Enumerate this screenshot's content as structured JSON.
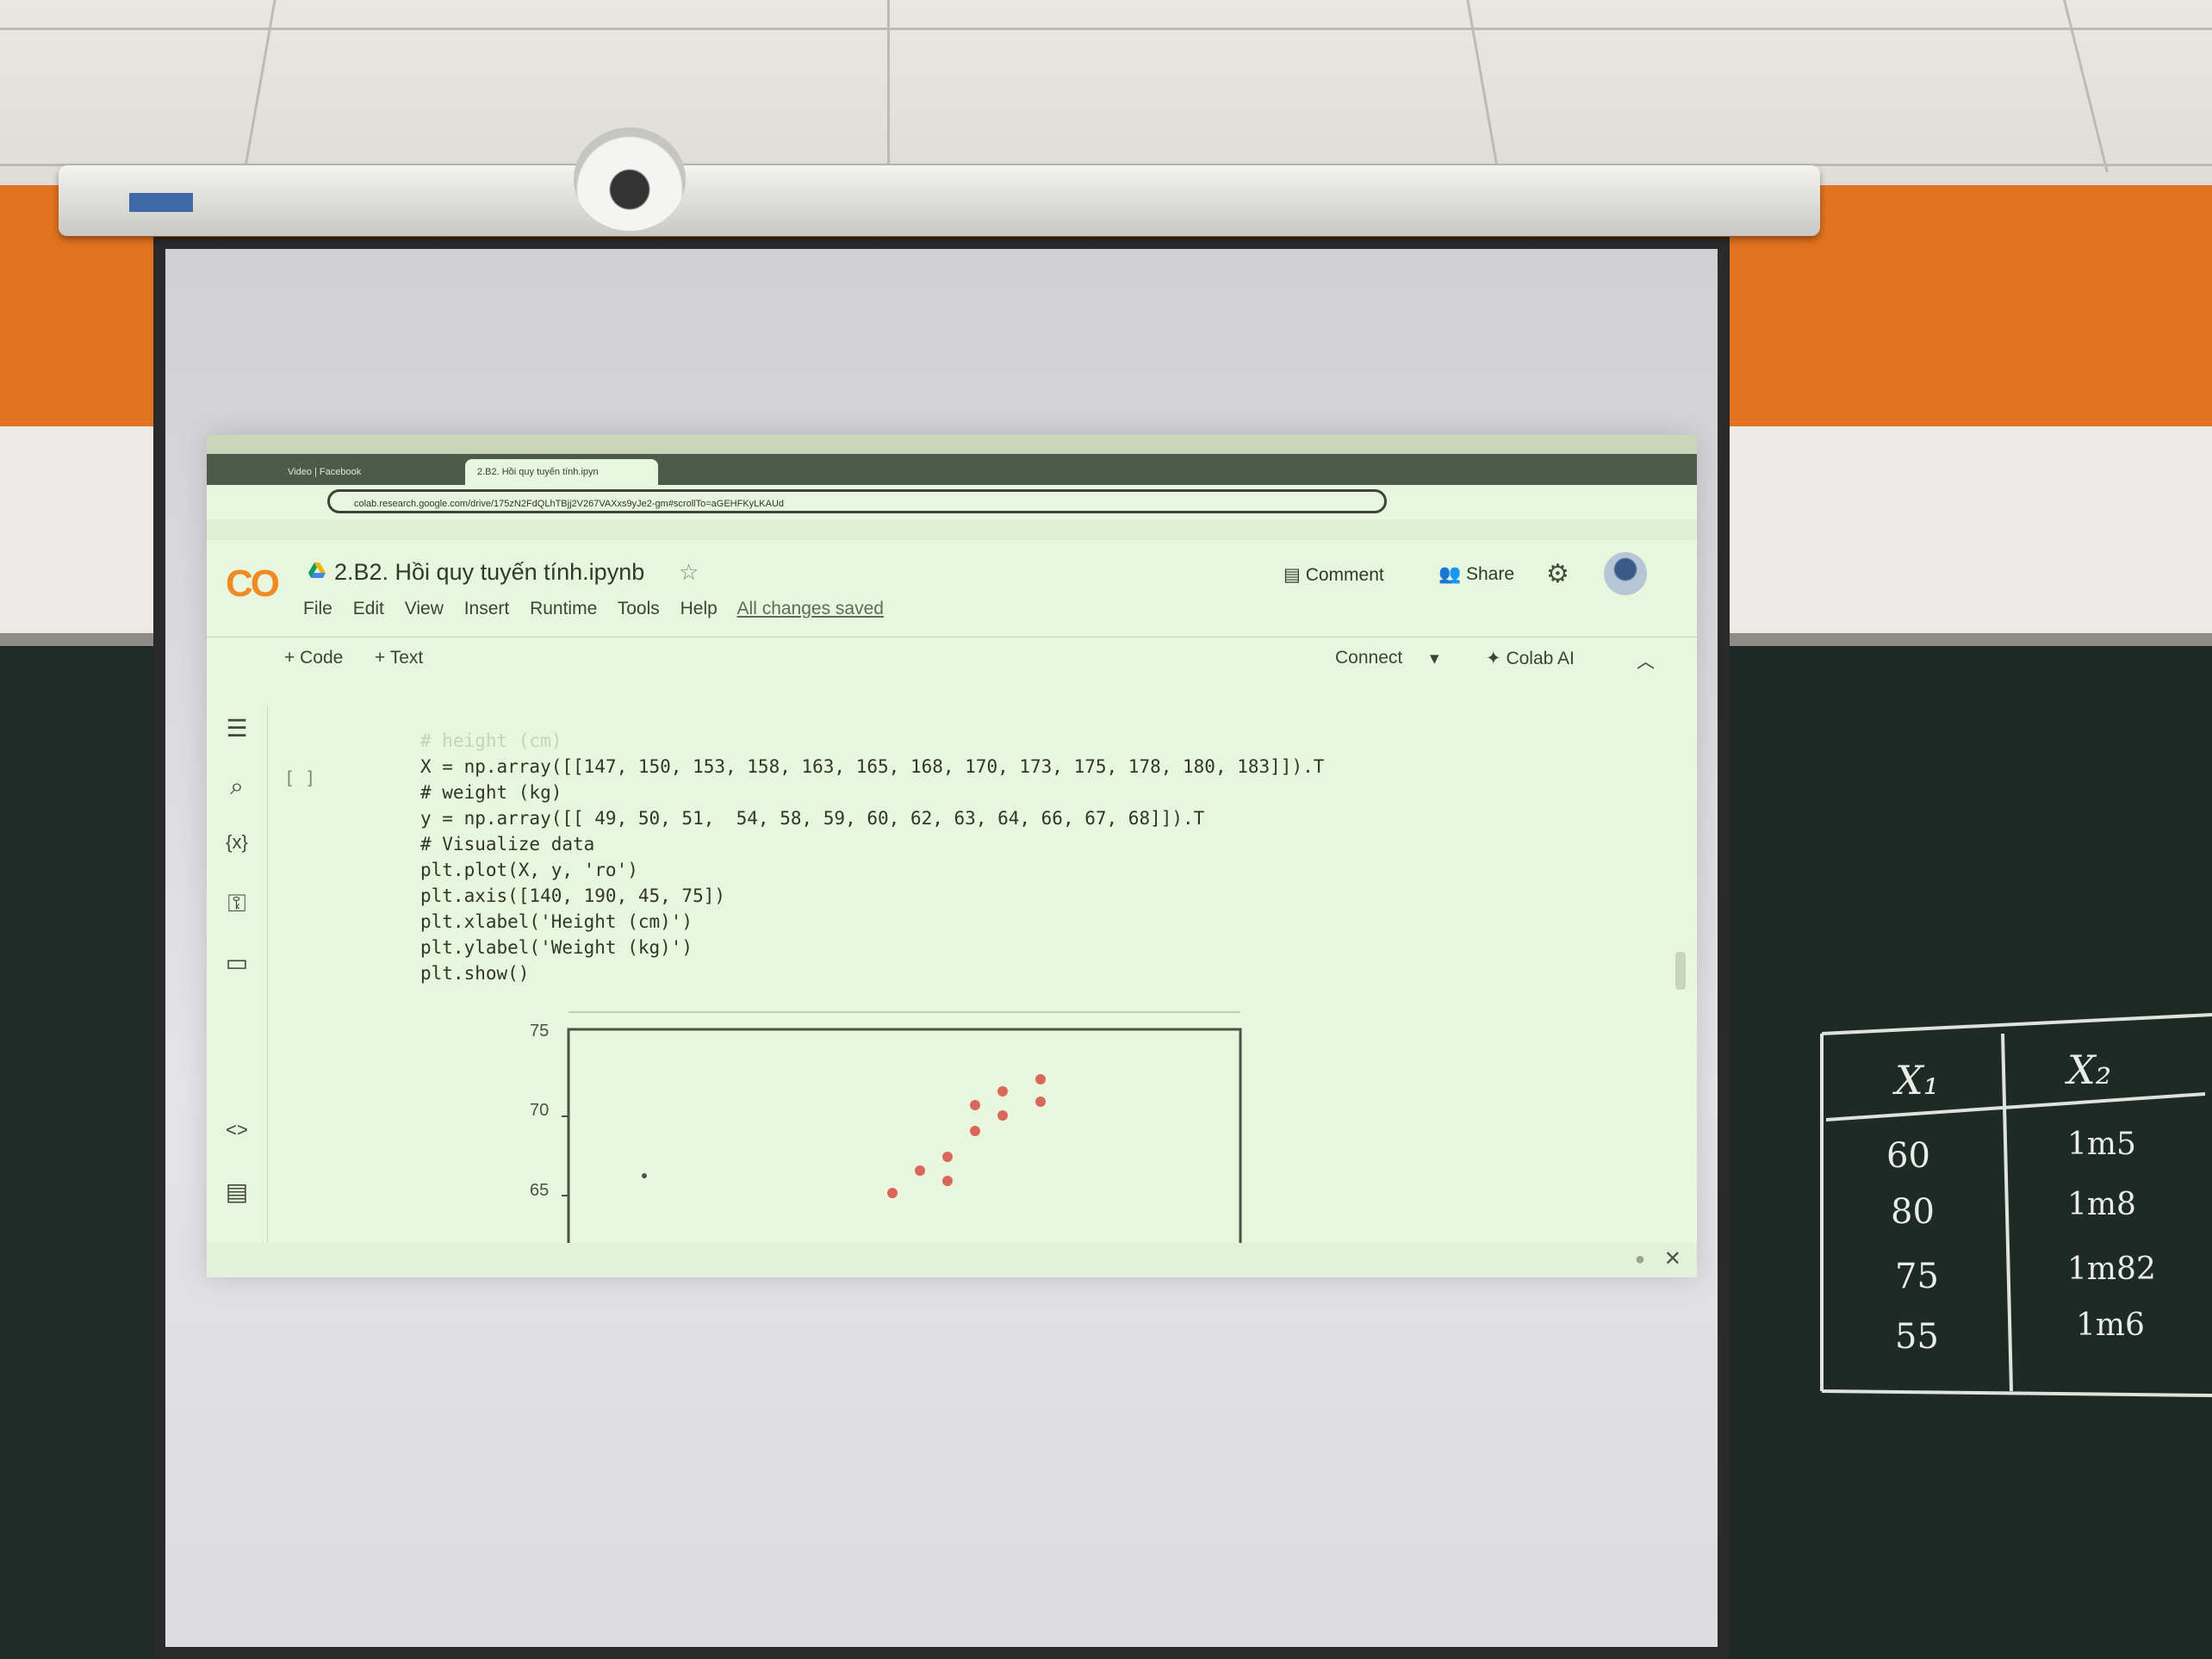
{
  "projected_window": {
    "tabs": [
      "Video | Facebook",
      "2.B2. Hồi quy tuyến tính.ipyn"
    ],
    "url": "colab.research.google.com/drive/175zN2FdQLhTBjj2V267VAXxs9yJe2-gm#scrollTo=aGEHFKyLKAUd",
    "notebook": {
      "logo": "CO",
      "title": "2.B2. Hồi quy tuyến tính.ipynb",
      "menus": [
        "File",
        "Edit",
        "View",
        "Insert",
        "Runtime",
        "Tools",
        "Help"
      ],
      "status": "All changes saved",
      "comment_label": "Comment",
      "share_label": "Share",
      "add_code_label": "+ Code",
      "add_text_label": "+ Text",
      "connect_label": "Connect",
      "colab_ai_label": "Colab AI",
      "cell_marker": "[ ]",
      "code_lines": [
        "# height (cm)",
        "X = np.array([[147, 150, 153, 158, 163, 165, 168, 170, 173, 175, 178, 180, 183]]).T",
        "# weight (kg)",
        "y = np.array([[ 49, 50, 51,  54, 58, 59, 60, 62, 63, 64, 66, 67, 68]]).T",
        "# Visualize data",
        "plt.plot(X, y, 'ro')",
        "plt.axis([140, 190, 45, 75])",
        "plt.xlabel('Height (cm)')",
        "plt.ylabel('Weight (kg)')",
        "plt.show()"
      ],
      "plot_y_ticks": [
        "75",
        "70",
        "65"
      ]
    }
  },
  "chalkboard_table": {
    "headers": [
      "X₁",
      "X₂"
    ],
    "rows": [
      [
        "60",
        "1m5"
      ],
      [
        "80",
        "1m8"
      ],
      [
        "75",
        "1m82"
      ],
      [
        "55",
        "1m6"
      ]
    ]
  }
}
